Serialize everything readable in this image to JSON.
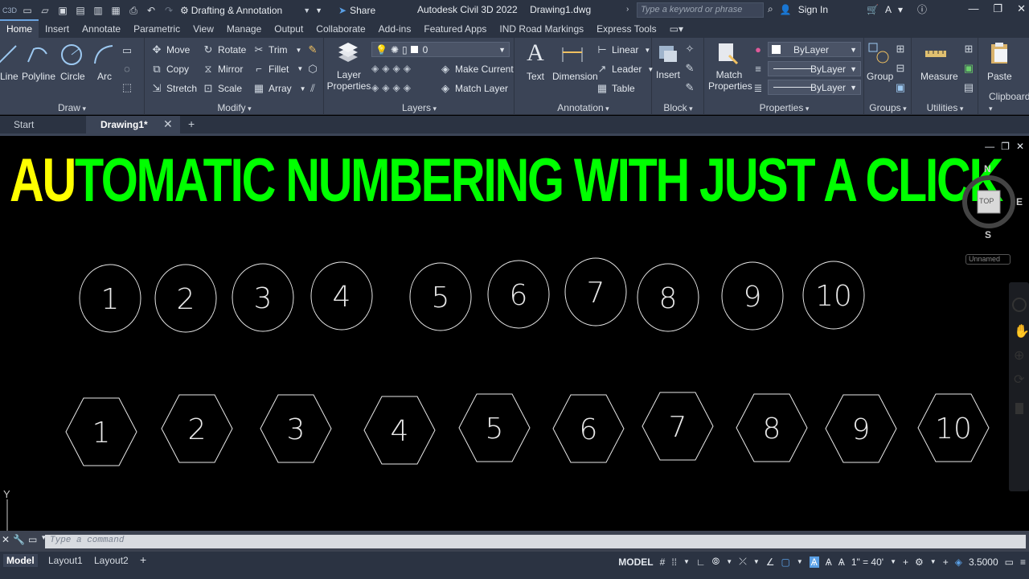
{
  "title_bar": {
    "workspace": "Drafting & Annotation",
    "share_label": "Share",
    "app_name": "Autodesk Civil 3D 2022",
    "doc_name": "Drawing1.dwg",
    "search_placeholder": "Type a keyword or phrase",
    "sign_in": "Sign In"
  },
  "ribbon_tabs": [
    "Home",
    "Insert",
    "Annotate",
    "Parametric",
    "View",
    "Manage",
    "Output",
    "Collaborate",
    "Add-ins",
    "Featured Apps",
    "IND Road Markings",
    "Express Tools"
  ],
  "ribbon": {
    "draw": {
      "label": "Draw",
      "line": "Line",
      "polyline": "Polyline",
      "circle": "Circle",
      "arc": "Arc"
    },
    "modify": {
      "label": "Modify",
      "move": "Move",
      "rotate": "Rotate",
      "trim": "Trim",
      "copy": "Copy",
      "mirror": "Mirror",
      "fillet": "Fillet",
      "stretch": "Stretch",
      "scale": "Scale",
      "array": "Array"
    },
    "layers": {
      "label": "Layers",
      "layer_properties": "Layer Properties",
      "current_layer": "0",
      "make_current": "Make Current",
      "match_layer": "Match Layer"
    },
    "annotation": {
      "label": "Annotation",
      "text": "Text",
      "dimension": "Dimension",
      "linear": "Linear",
      "leader": "Leader",
      "table": "Table"
    },
    "block": {
      "label": "Block",
      "insert": "Insert"
    },
    "properties": {
      "label": "Properties",
      "match_properties": "Match Properties",
      "color": "ByLayer",
      "linetype": "ByLayer",
      "lineweight": "ByLayer"
    },
    "groups": {
      "label": "Groups",
      "group": "Group"
    },
    "utilities": {
      "label": "Utilities",
      "measure": "Measure"
    },
    "clipboard": {
      "label": "Clipboard",
      "paste": "Paste"
    }
  },
  "file_tabs": {
    "start": "Start",
    "drawing": "Drawing1*"
  },
  "canvas": {
    "headline_yellow": "AU",
    "headline_green": "TOMATIC NUMBERING WITH JUST A CLICK",
    "circle_numbers": [
      "1",
      "2",
      "3",
      "4",
      "5",
      "6",
      "7",
      "8",
      "9",
      "10"
    ],
    "hexagon_numbers": [
      "1",
      "2",
      "3",
      "4",
      "5",
      "6",
      "7",
      "8",
      "9",
      "10"
    ],
    "viewcube": {
      "n": "N",
      "e": "E",
      "s": "S",
      "top": "TOP"
    },
    "ucs_label": "Y",
    "view_name": "Unnamed"
  },
  "command_line": {
    "placeholder": "Type a command"
  },
  "status_bar": {
    "layouts": [
      "Model",
      "Layout1",
      "Layout2"
    ],
    "model": "MODEL",
    "scale": "1\" = 40'",
    "annotation_scale": "3.5000"
  },
  "colors": {
    "headline_yellow": "#ffff00",
    "headline_green": "#00ff00",
    "ui_dark": "#2b3342",
    "ribbon": "#3b4456"
  }
}
